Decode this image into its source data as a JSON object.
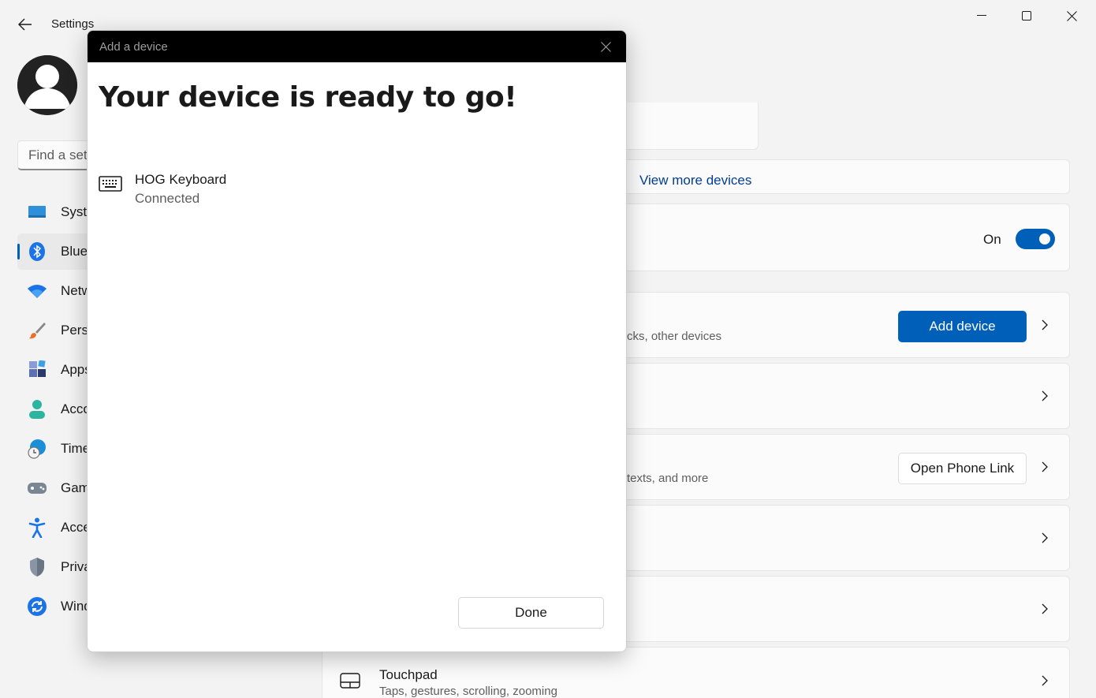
{
  "window": {
    "title": "Settings",
    "controls": [
      "minimize",
      "maximize",
      "close"
    ]
  },
  "sidebar": {
    "search_placeholder": "Find a setting",
    "items": [
      {
        "label": "System",
        "icon": "system-icon"
      },
      {
        "label": "Bluetooth & devices",
        "icon": "bluetooth-icon",
        "active": true
      },
      {
        "label": "Network & internet",
        "icon": "wifi-icon"
      },
      {
        "label": "Personalization",
        "icon": "brush-icon"
      },
      {
        "label": "Apps",
        "icon": "apps-icon"
      },
      {
        "label": "Accounts",
        "icon": "account-icon"
      },
      {
        "label": "Time & language",
        "icon": "globe-clock-icon"
      },
      {
        "label": "Gaming",
        "icon": "gamepad-icon"
      },
      {
        "label": "Accessibility",
        "icon": "accessibility-icon"
      },
      {
        "label": "Privacy & security",
        "icon": "shield-icon"
      },
      {
        "label": "Windows Update",
        "icon": "update-icon"
      }
    ]
  },
  "main": {
    "view_more_devices": "View more devices",
    "bluetooth_toggle_state": "On",
    "devices_desc_fragment": "cks, other devices",
    "add_device_button": "Add device",
    "phone_desc_fragment": "texts, and more",
    "open_phone_link_button": "Open Phone Link",
    "touchpad": {
      "title": "Touchpad",
      "desc": "Taps, gestures, scrolling, zooming"
    }
  },
  "dialog": {
    "bar_title": "Add a device",
    "heading": "Your device is ready to go!",
    "device": {
      "name": "HOG Keyboard",
      "status": "Connected",
      "icon": "keyboard-icon"
    },
    "done_button": "Done"
  },
  "colors": {
    "accent": "#005fb8",
    "link": "#003e92",
    "background": "#f3f3f3",
    "dialog_bar": "#000000"
  }
}
